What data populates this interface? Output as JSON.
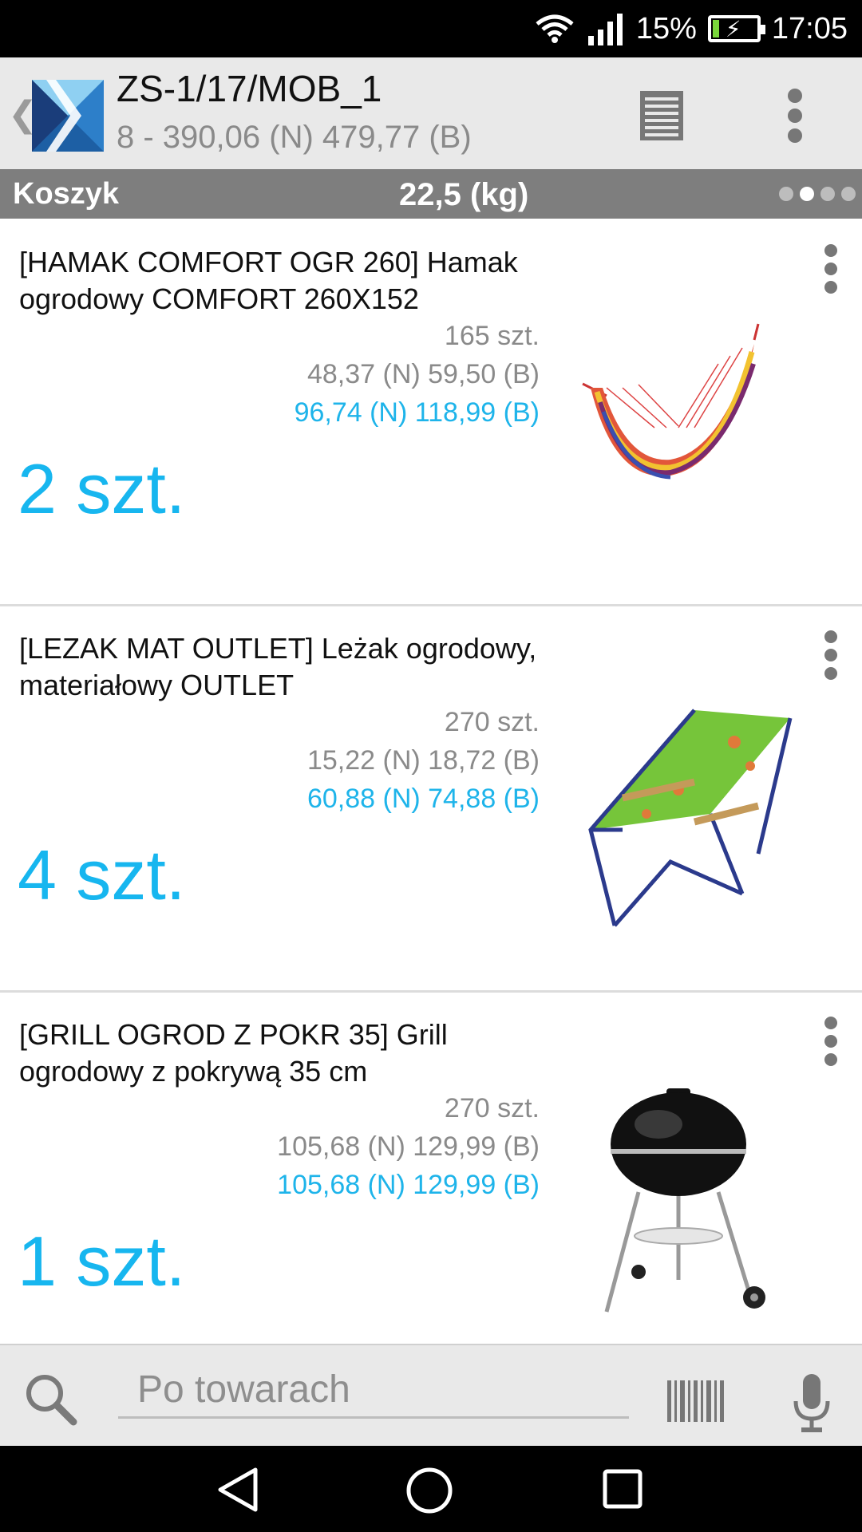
{
  "status_bar": {
    "battery_percent": "15%",
    "time": "17:05",
    "icons": [
      "wifi-icon",
      "signal-icon",
      "battery-charging-icon"
    ],
    "battery_level": 0.15
  },
  "header": {
    "title": "ZS-1/17/MOB_1",
    "subtitle": "8 - 390,06 (N) 479,77 (B)",
    "icons": [
      "back-chevron-icon",
      "app-logo",
      "list-icon",
      "overflow-menu-icon"
    ]
  },
  "basket": {
    "label": "Koszyk",
    "weight": "22,5 (kg)",
    "pages": 4,
    "active_page": 2
  },
  "items": [
    {
      "name": "[HAMAK COMFORT OGR 260] Hamak ogrodowy COMFORT 260X152",
      "stock": "165 szt.",
      "unit_price": "48,37 (N)  59,50 (B)",
      "total_price": "96,74 (N) 118,99 (B)",
      "quantity": "2 szt.",
      "image": "hammock-image"
    },
    {
      "name": "[LEZAK MAT OUTLET] Leżak ogrodowy, materiałowy OUTLET",
      "stock": "270 szt.",
      "unit_price": "15,22 (N)  18,72 (B)",
      "total_price": "60,88 (N) 74,88 (B)",
      "quantity": "4 szt.",
      "image": "deck-chair-image"
    },
    {
      "name": "[GRILL OGROD Z POKR 35] Grill ogrodowy z pokrywą 35 cm",
      "stock": "270 szt.",
      "unit_price": "105,68 (N)  129,99 (B)",
      "total_price": "105,68 (N) 129,99 (B)",
      "quantity": "1 szt.",
      "image": "grill-image"
    }
  ],
  "search": {
    "placeholder": "Po towarach",
    "icons": [
      "search-icon",
      "barcode-icon",
      "microphone-icon"
    ]
  },
  "nav": {
    "icons": [
      "nav-back-icon",
      "nav-home-icon",
      "nav-recent-icon"
    ]
  },
  "colors": {
    "accent": "#17b6ef",
    "status_bar": "#000000",
    "app_bar": "#e9e9e9",
    "basket_bar": "#7e7e7e",
    "muted_text": "#8a8a8a"
  }
}
